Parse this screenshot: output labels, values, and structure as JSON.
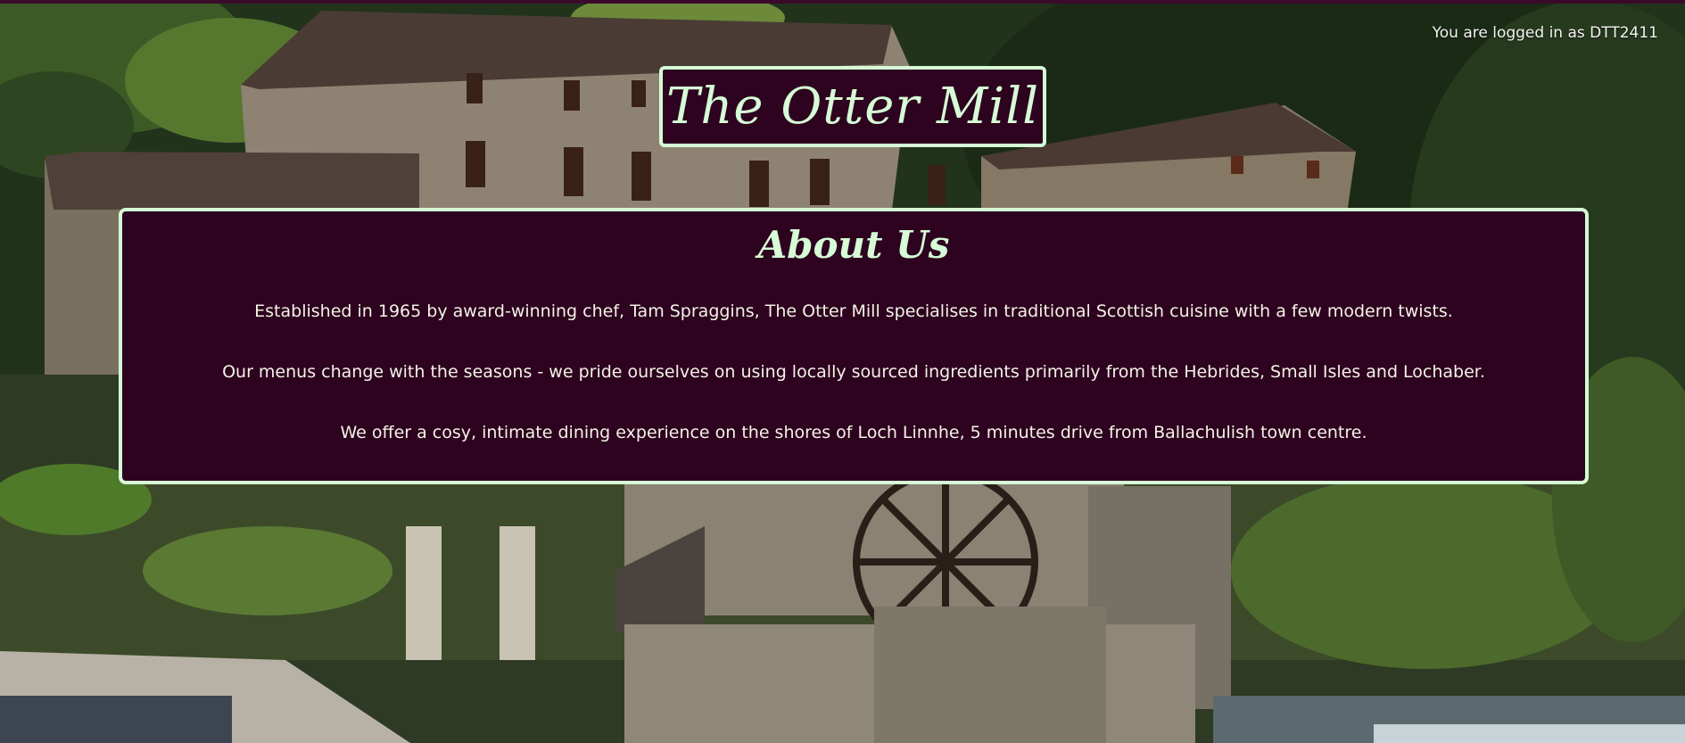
{
  "header": {
    "login_status": "You are logged in as DTT2411",
    "site_title": "The Otter Mill"
  },
  "about": {
    "heading": "About Us",
    "paragraphs": [
      "Established in 1965 by award-winning chef, Tam Spraggins, The Otter Mill specialises in traditional Scottish cuisine with a few modern twists.",
      "Our menus change with the seasons - we pride ourselves on using locally sourced ingredients primarily from the Hebrides, Small Isles and Lochaber.",
      "We offer a cosy, intimate dining experience on the shores of Loch Linnhe, 5 minutes drive from Ballachulish town centre."
    ]
  },
  "colors": {
    "panel_background": "#2d031f",
    "panel_border": "#d6fbd6",
    "title_text": "#d6fbd6",
    "body_text": "#f4f2e6"
  }
}
